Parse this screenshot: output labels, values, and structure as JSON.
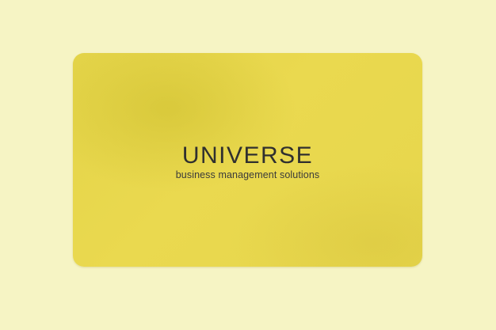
{
  "card": {
    "brand": "UNIVERSE",
    "tagline": "business management solutions"
  },
  "colors": {
    "background": "#f6f4c4",
    "card": "#e8d84e",
    "text": "#2f2f2f"
  }
}
